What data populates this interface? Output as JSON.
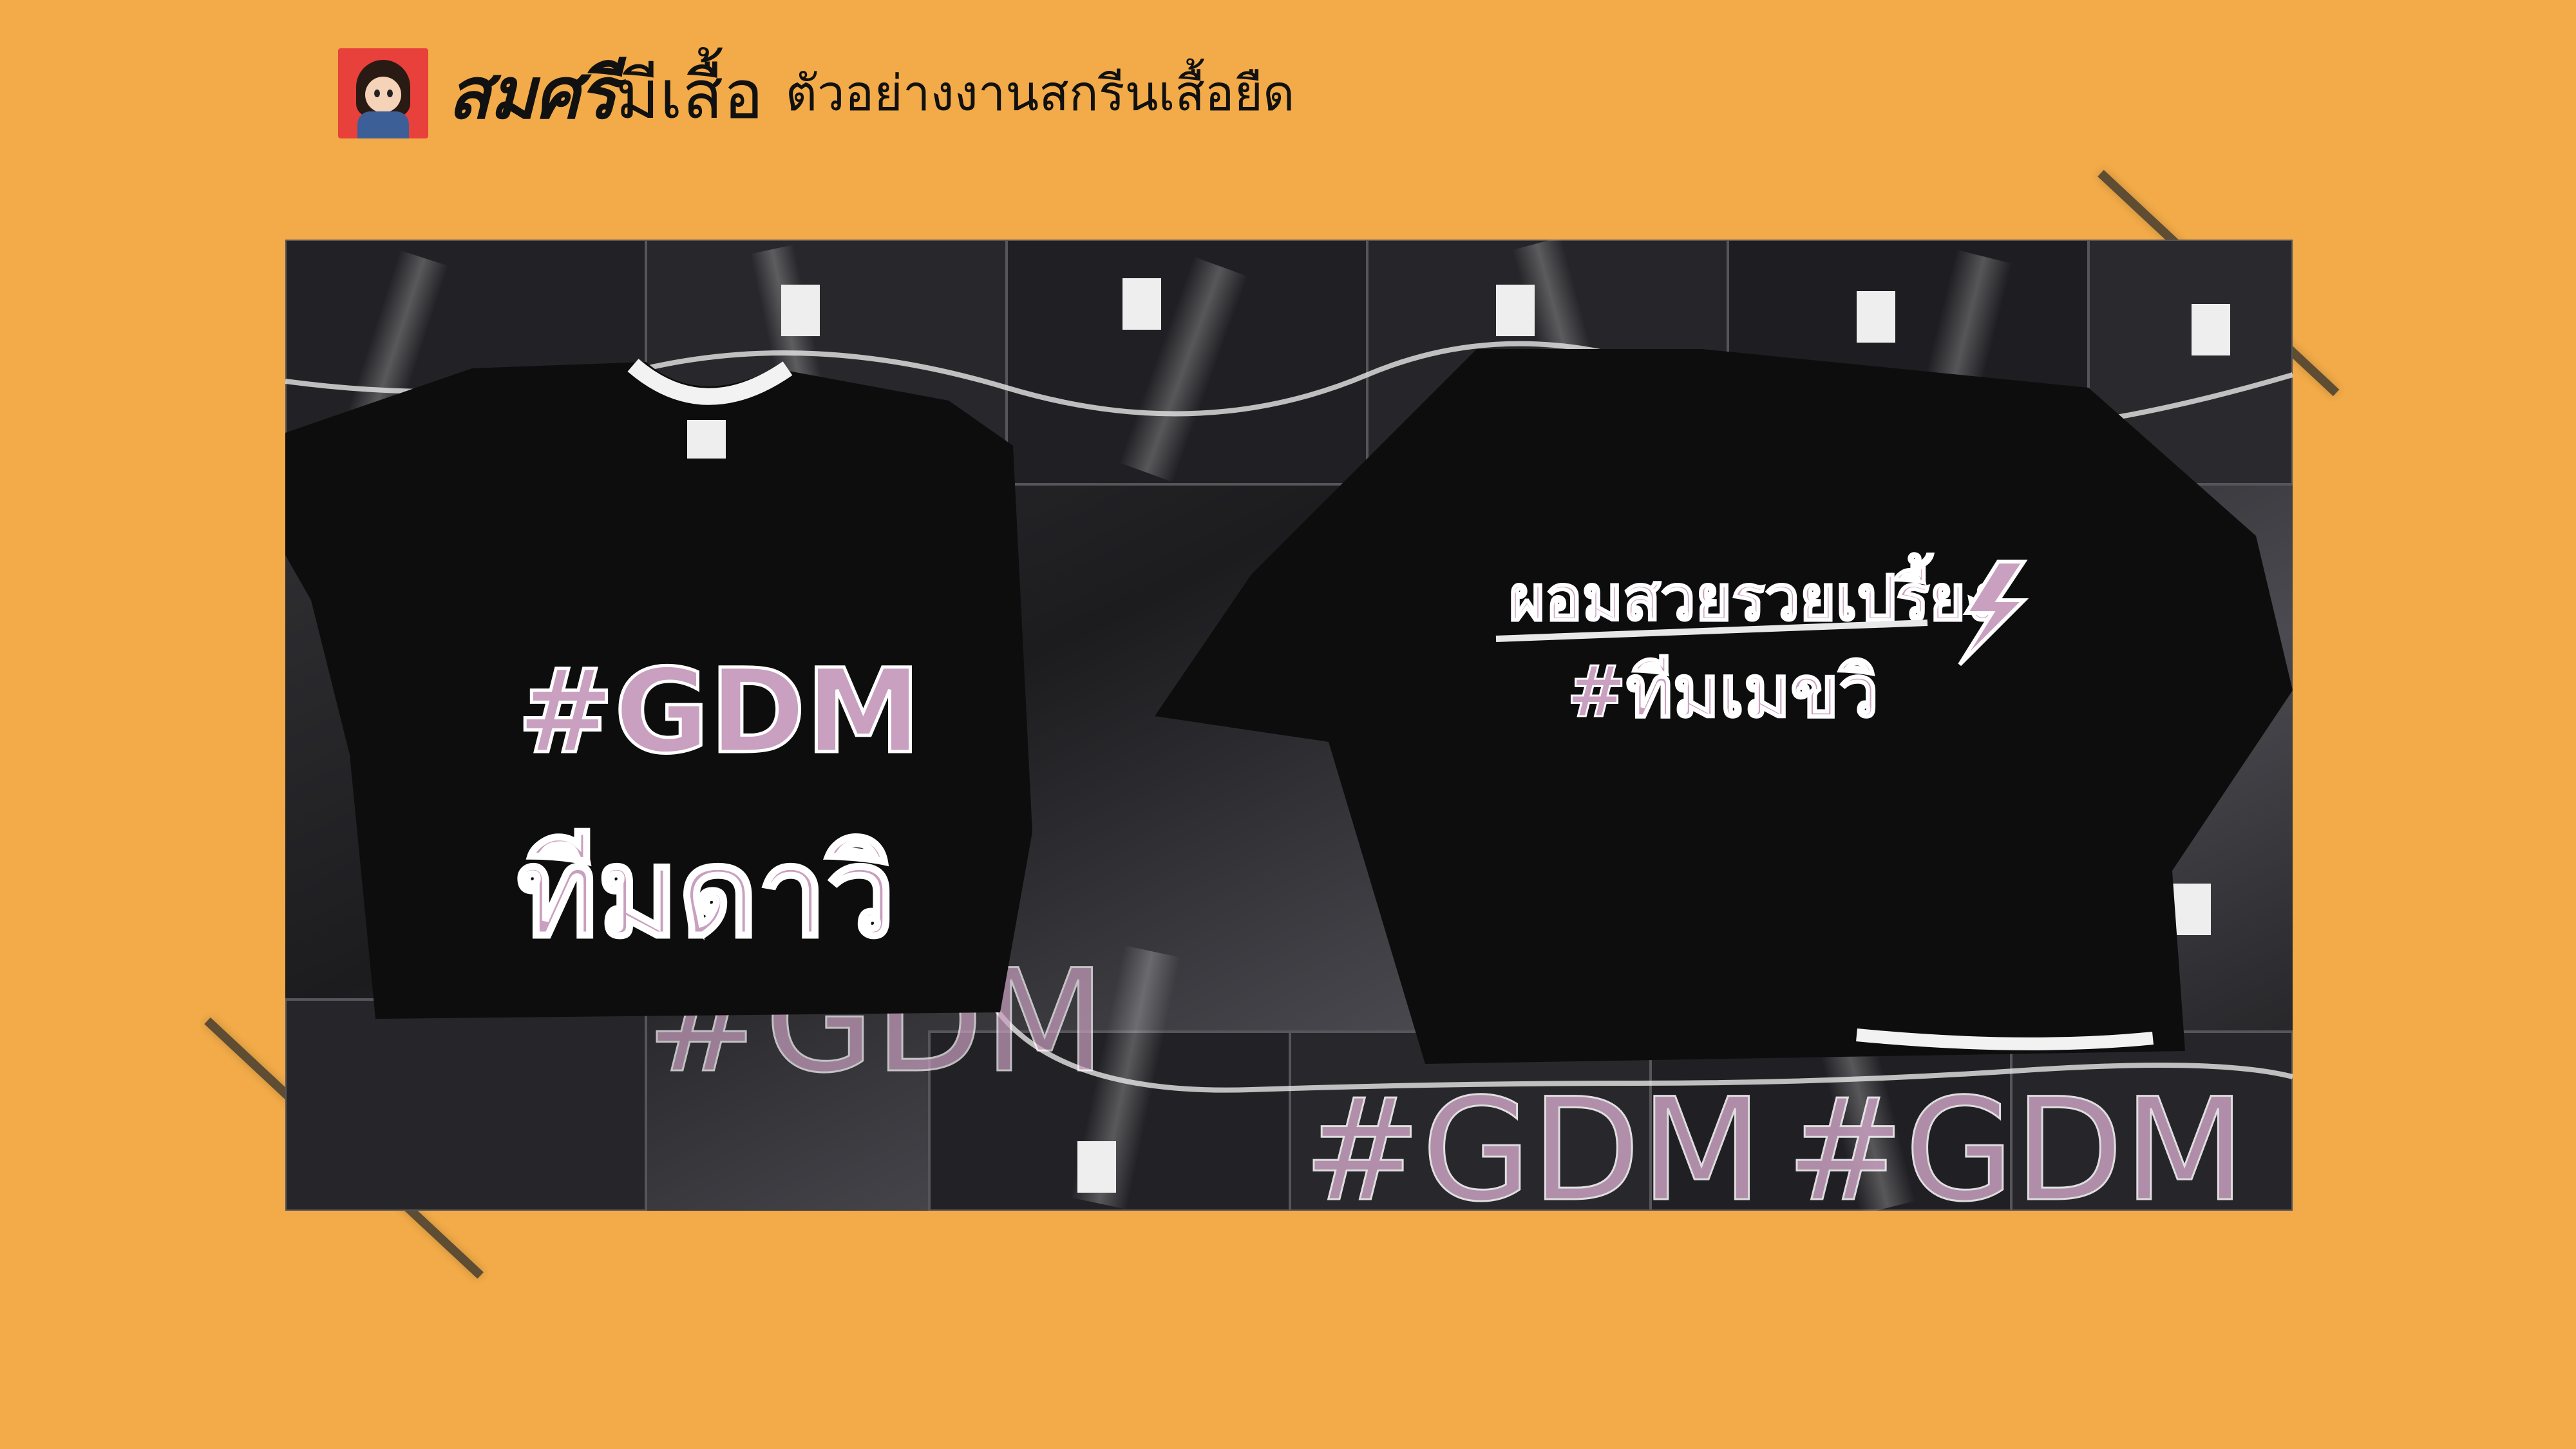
{
  "header": {
    "logo_mascot": "mascot-logo",
    "brand_main": "สมศรี",
    "brand_sub": "มีเสื้อ",
    "tagline": "ตัวอย่างงานสกรีนเสื้อยืด"
  },
  "photo": {
    "shirt_left_line1": "#GDM",
    "shirt_left_line2": "ทีมดาวิ",
    "shirt_right_line1": "ผอมสวยรวยเปรี้ยง",
    "shirt_right_line2": "#ทีมเมขวิ",
    "bg_print_1": "#GDM",
    "bg_print_2": "#GDM",
    "bg_print_3": "#GDM"
  },
  "colors": {
    "background": "#F2AB48",
    "print_pink": "#c9a0c0",
    "shirt_black": "#0d0d0d"
  }
}
